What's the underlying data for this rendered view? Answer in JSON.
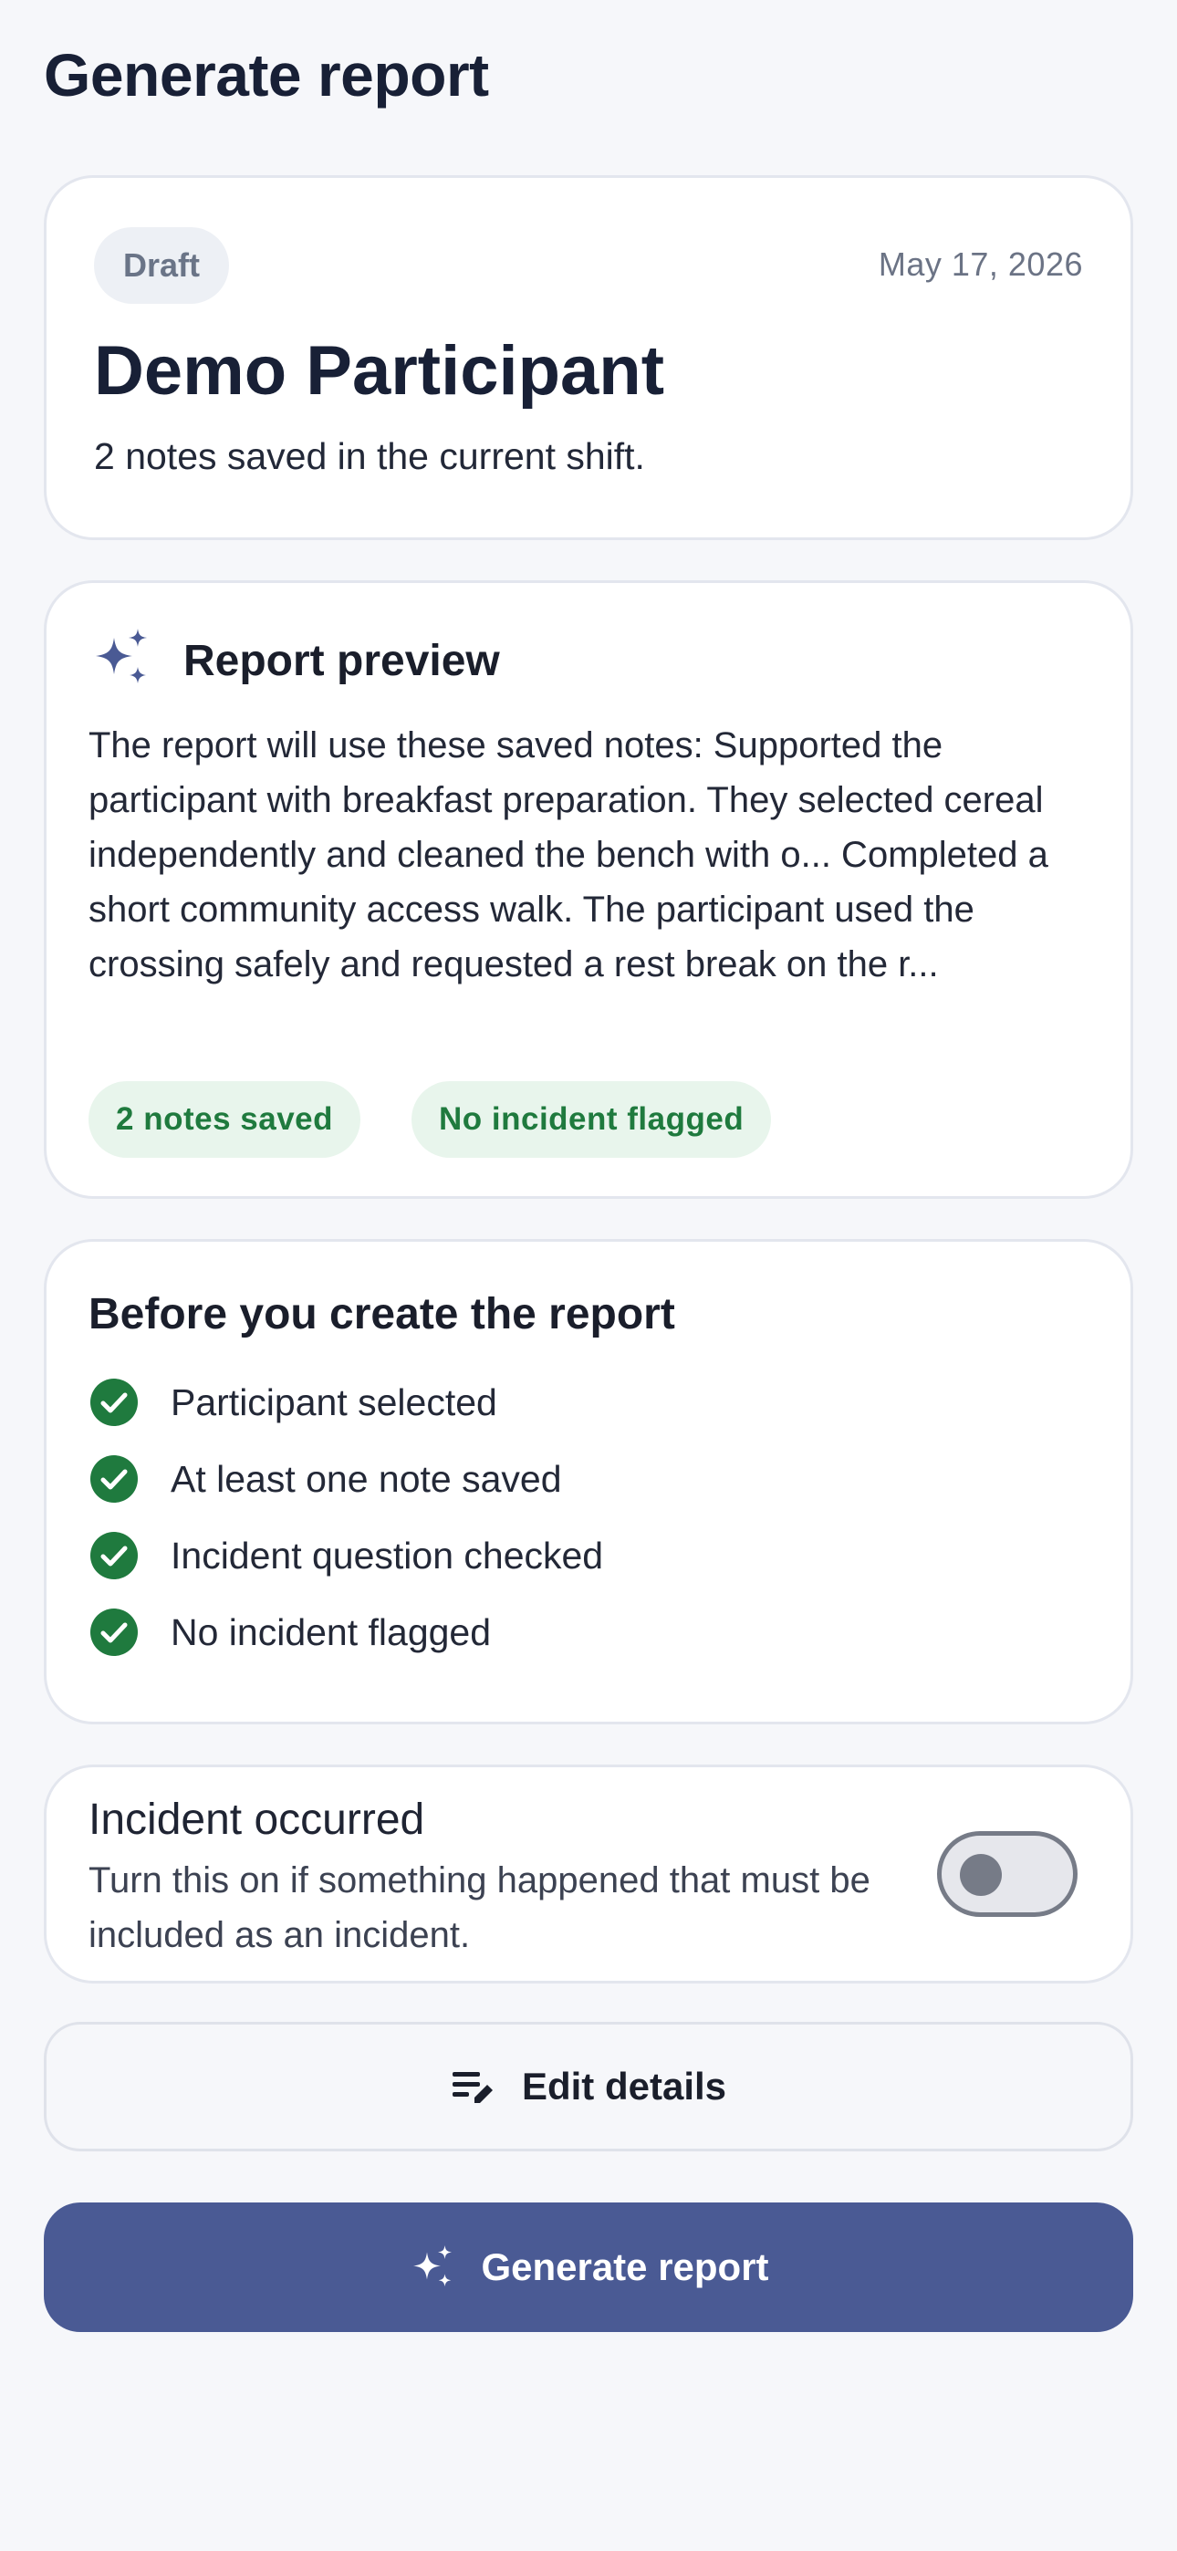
{
  "header": {
    "title": "Generate report"
  },
  "participant_card": {
    "status_badge": "Draft",
    "date": "May 17, 2026",
    "name": "Demo Participant",
    "notes_summary": "2 notes saved in the current shift."
  },
  "preview_card": {
    "icon": "sparkle-icon",
    "title": "Report preview",
    "body": "The report will use these saved notes: Supported the participant with breakfast preparation. They selected cereal independently and cleaned the bench with o... Completed a short community access walk. The participant used the crossing safely and requested a rest break on the r...",
    "chips": [
      "2 notes saved",
      "No incident flagged"
    ]
  },
  "checklist_card": {
    "title": "Before you create the report",
    "items": [
      "Participant selected",
      "At least one note saved",
      "Incident question checked",
      "No incident flagged"
    ]
  },
  "incident_card": {
    "title": "Incident occurred",
    "description": "Turn this on if something happened that must be included as an incident.",
    "toggle_state": "off"
  },
  "actions": {
    "edit_label": "Edit details",
    "edit_icon": "edit-notes-icon",
    "generate_label": "Generate report",
    "generate_icon": "sparkle-icon"
  },
  "colors": {
    "primary": "#4a5a94",
    "success": "#1f7a3e",
    "success_bg": "#e8f5ec",
    "background": "#f6f7fa"
  }
}
